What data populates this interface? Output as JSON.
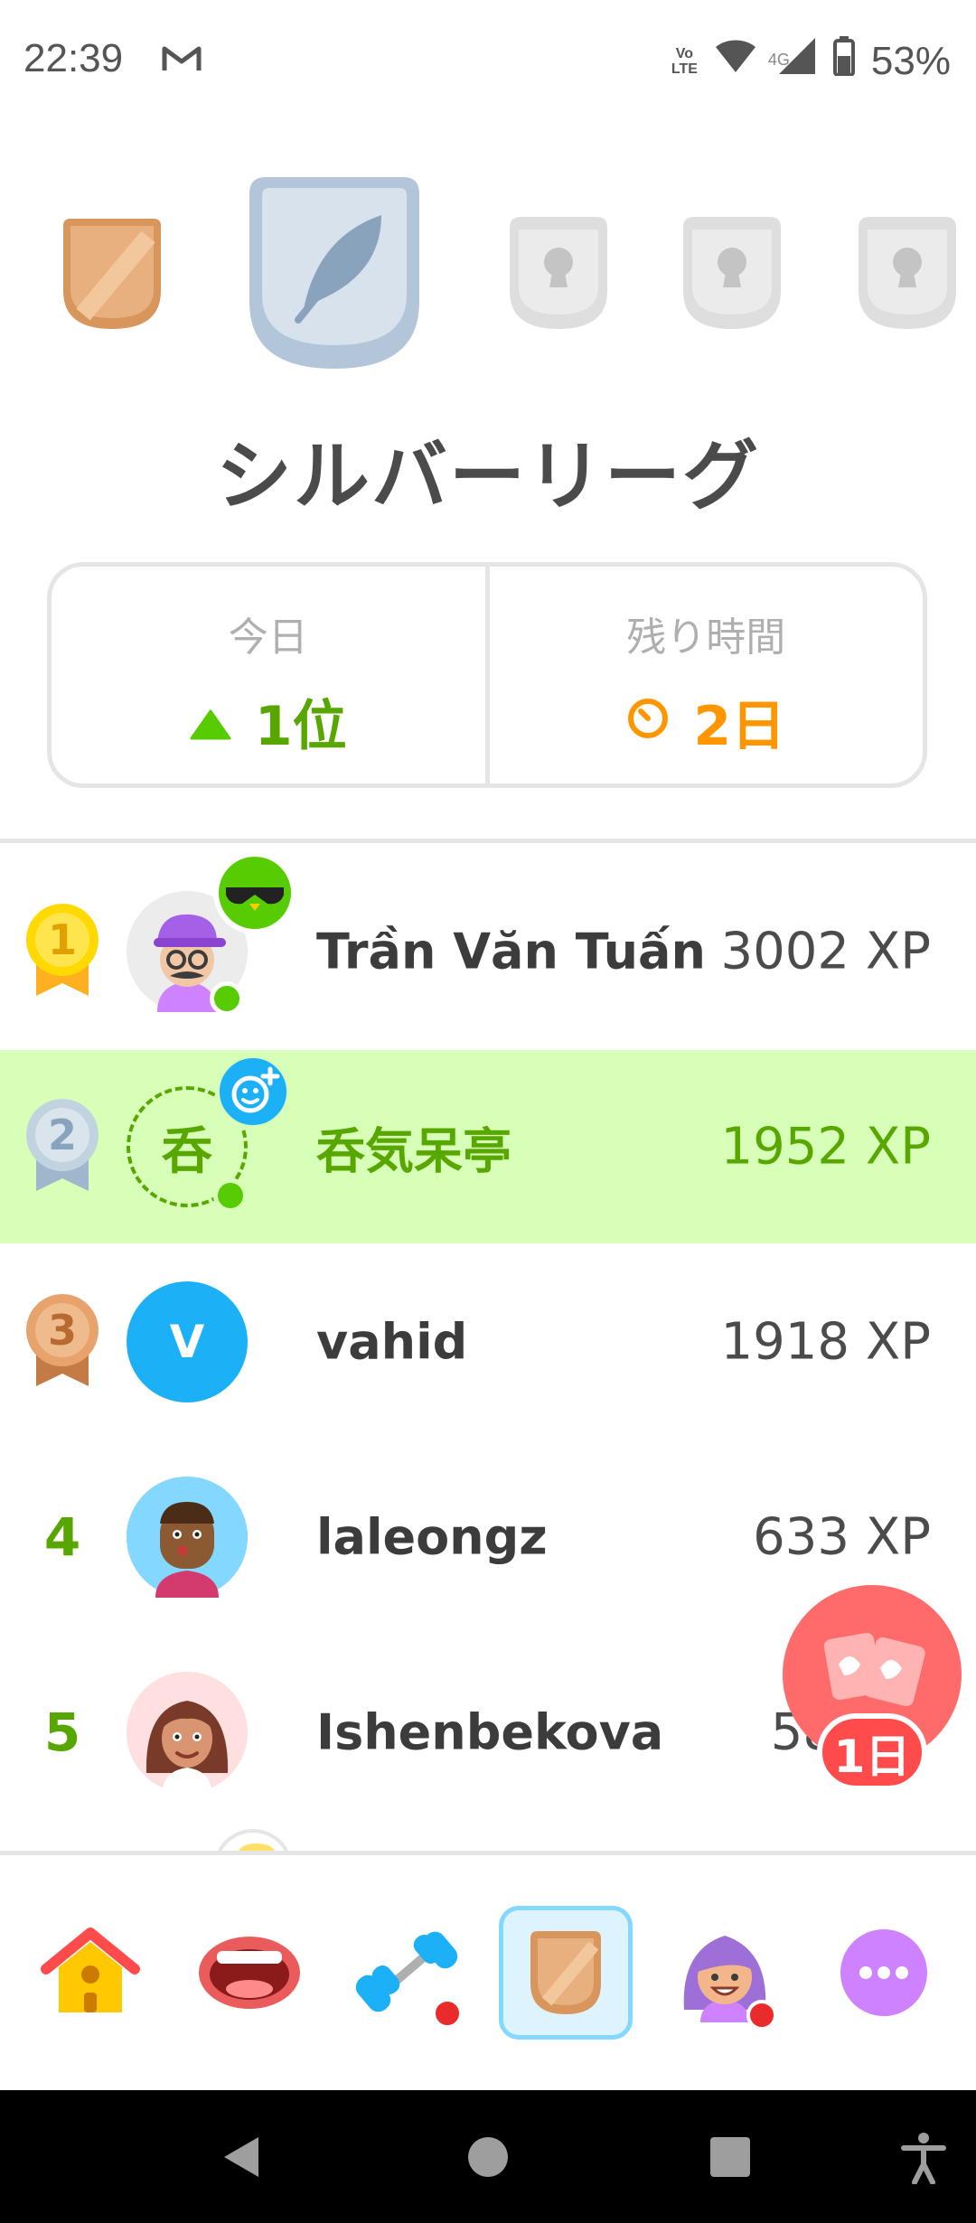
{
  "status_bar": {
    "time": "22:39",
    "battery": "53%",
    "network": "4G",
    "volte_top": "Vo",
    "volte_bottom": "LTE"
  },
  "league": {
    "title": "シルバーリーグ"
  },
  "stats": {
    "today_label": "今日",
    "today_value": "1位",
    "remaining_label": "残り時間",
    "remaining_value": "2日"
  },
  "leaderboard": [
    {
      "rank": "1",
      "name": "Trần Văn Tuấn",
      "xp": "3002 XP"
    },
    {
      "rank": "2",
      "name": "呑気呆亭",
      "xp": "1952 XP",
      "avatar_letter": "呑"
    },
    {
      "rank": "3",
      "name": "vahid",
      "xp": "1918 XP",
      "avatar_letter": "V"
    },
    {
      "rank": "4",
      "name": "laleongz",
      "xp": "633 XP"
    },
    {
      "rank": "5",
      "name": "Ishenbekova",
      "xp": "58"
    }
  ],
  "chest": {
    "label": "1日"
  },
  "colors": {
    "green": "#58a700",
    "orange": "#ff9600",
    "highlight": "#d7ffb8",
    "accent_blue": "#1cb0f6"
  },
  "icons": [
    "home-icon",
    "speak-icon",
    "practice-icon",
    "leaderboard-icon",
    "profile-icon",
    "more-icon"
  ]
}
